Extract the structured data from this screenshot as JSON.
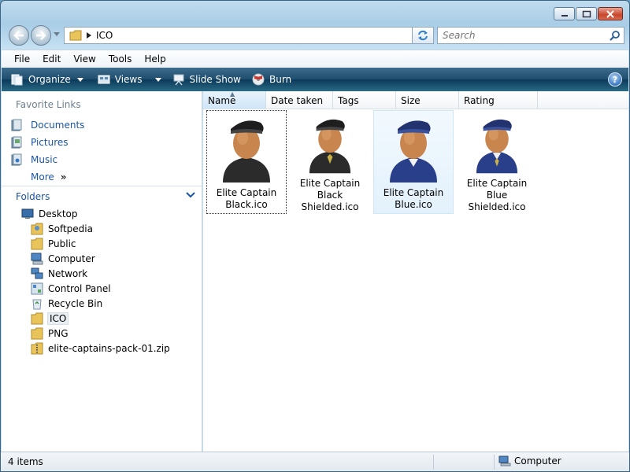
{
  "address": {
    "crumb": "ICO"
  },
  "search": {
    "placeholder": "Search"
  },
  "menu": [
    "File",
    "Edit",
    "View",
    "Tools",
    "Help"
  ],
  "commands": {
    "organize": "Organize",
    "views": "Views",
    "slideshow": "Slide Show",
    "burn": "Burn",
    "help": "?"
  },
  "favorites": {
    "title": "Favorite Links",
    "items": [
      {
        "label": "Documents",
        "icon": "documents-icon"
      },
      {
        "label": "Pictures",
        "icon": "pictures-icon"
      },
      {
        "label": "Music",
        "icon": "music-icon"
      }
    ],
    "more": "More",
    "more_chevron": "»"
  },
  "folders": {
    "title": "Folders",
    "tree": [
      {
        "label": "Desktop",
        "icon": "desktop-icon",
        "level": 0
      },
      {
        "label": "Softpedia",
        "icon": "user-folder-icon",
        "level": 1
      },
      {
        "label": "Public",
        "icon": "folder-icon",
        "level": 1
      },
      {
        "label": "Computer",
        "icon": "computer-icon",
        "level": 1
      },
      {
        "label": "Network",
        "icon": "network-icon",
        "level": 1
      },
      {
        "label": "Control Panel",
        "icon": "control-panel-icon",
        "level": 1
      },
      {
        "label": "Recycle Bin",
        "icon": "recycle-bin-icon",
        "level": 1
      },
      {
        "label": "ICO",
        "icon": "folder-icon",
        "level": 1,
        "selected": true
      },
      {
        "label": "PNG",
        "icon": "folder-icon",
        "level": 1
      },
      {
        "label": "elite-captains-pack-01.zip",
        "icon": "zip-folder-icon",
        "level": 1
      }
    ]
  },
  "columns": [
    "Name",
    "Date taken",
    "Tags",
    "Size",
    "Rating"
  ],
  "sorted_column": "Name",
  "files": [
    {
      "line1": "Elite Captain",
      "line2": "Black.ico",
      "color": "#2b2b2b",
      "shield": false
    },
    {
      "line1": "Elite Captain Black",
      "line2": "Shielded.ico",
      "color": "#2b2b2b",
      "shield": true
    },
    {
      "line1": "Elite Captain",
      "line2": "Blue.ico",
      "color": "#2a3f8a",
      "shield": false
    },
    {
      "line1": "Elite Captain Blue",
      "line2": "Shielded.ico",
      "color": "#2a3f8a",
      "shield": true
    }
  ],
  "status": {
    "count": "4 items",
    "zone": "Computer"
  },
  "colors": {
    "command_bar": "#1f4e6e",
    "link": "#1b55a3",
    "close_button": "#c9462c"
  }
}
